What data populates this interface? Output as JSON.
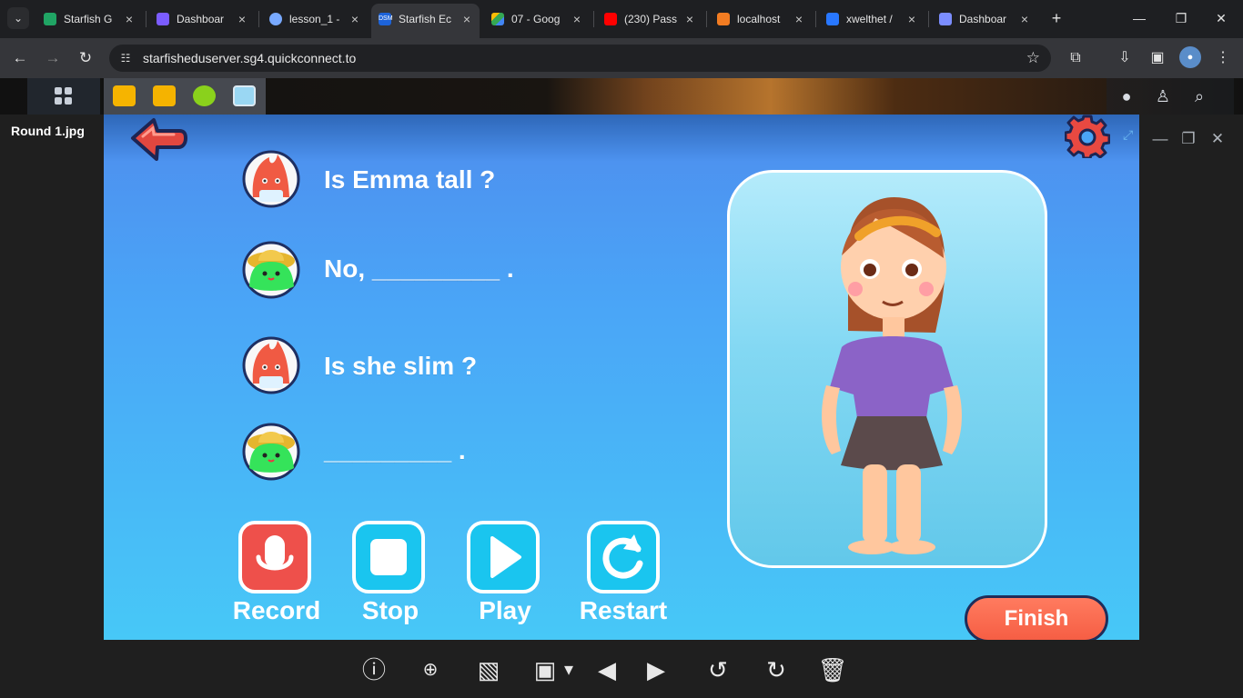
{
  "browser": {
    "tabs": [
      {
        "label": "Starfish G",
        "favicon": "sheets-icon",
        "active": false
      },
      {
        "label": "Dashboar",
        "favicon": "dashboard-icon",
        "active": false
      },
      {
        "label": "lesson_1 -",
        "favicon": "globe-icon",
        "active": false
      },
      {
        "label": "Starfish Ec",
        "favicon": "dsm-icon",
        "active": true
      },
      {
        "label": "07 - Goog",
        "favicon": "drive-icon",
        "active": false
      },
      {
        "label": "(230) Pass",
        "favicon": "youtube-icon",
        "active": false
      },
      {
        "label": "localhost",
        "favicon": "xampp-icon",
        "active": false
      },
      {
        "label": "xwelthet /",
        "favicon": "bookmark-icon",
        "active": false
      },
      {
        "label": "Dashboar",
        "favicon": "dashboard-icon",
        "active": false
      }
    ],
    "address": "starfisheduserver.sg4.quickconnect.to",
    "tab_close_icon": "close-icon",
    "new_tab_icon": "plus-icon"
  },
  "viewer": {
    "filename": "Round 1.jpg"
  },
  "lesson": {
    "dialogue": [
      {
        "speaker": "red-character",
        "text": "Is Emma tall ?"
      },
      {
        "speaker": "green-character",
        "text": "No, _________ ."
      },
      {
        "speaker": "red-character",
        "text": "Is she slim ?"
      },
      {
        "speaker": "green-character",
        "text": "_________ ."
      }
    ],
    "controls": {
      "record": "Record",
      "stop": "Stop",
      "play": "Play",
      "restart": "Restart"
    },
    "finish": "Finish"
  },
  "colors": {
    "stage_blue": "#4aa5f7",
    "record_red": "#ee504b",
    "control_cyan": "#1ac5ef",
    "finish_red": "#f65e44"
  }
}
